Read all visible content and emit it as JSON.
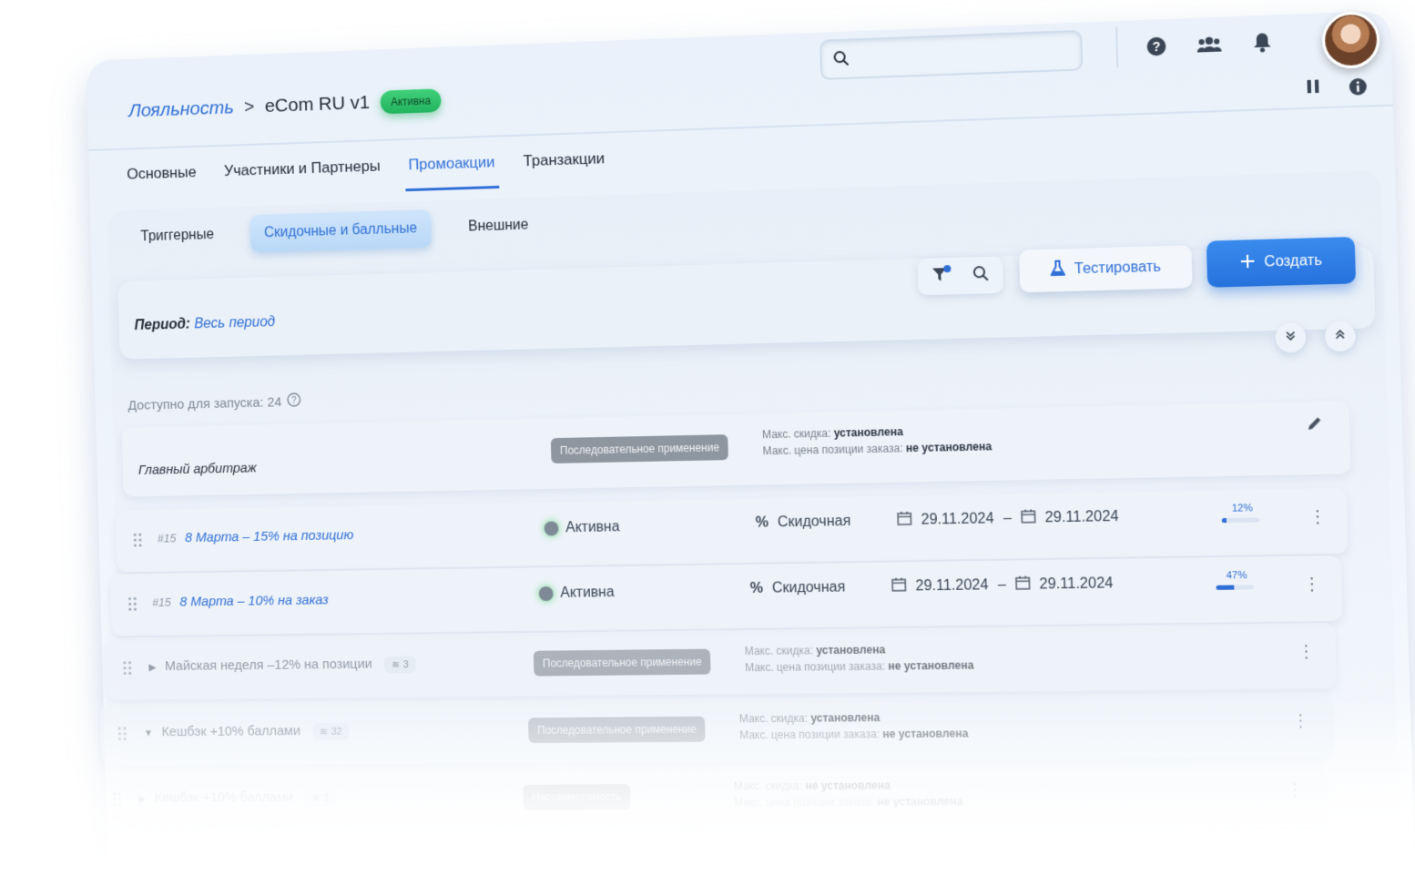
{
  "header": {
    "breadcrumb_root": "Лояльность",
    "breadcrumb_sep": ">",
    "breadcrumb_current": "eCom RU v1",
    "status_badge": "Активна"
  },
  "tabs": [
    {
      "label": "Основные"
    },
    {
      "label": "Участники и Партнеры"
    },
    {
      "label": "Промоакции"
    },
    {
      "label": "Транзакции"
    }
  ],
  "subtabs": [
    {
      "label": "Триггерные"
    },
    {
      "label": "Скидочные и балльные"
    },
    {
      "label": "Внешние"
    }
  ],
  "toolbar": {
    "test_label": "Тестировать",
    "create_label": "Создать"
  },
  "period": {
    "label": "Период:",
    "value": "Весь период"
  },
  "available": "Доступно для запуска: 24",
  "arbitrage": {
    "name": "Главный арбитраж",
    "mode": "Последовательное применение",
    "max_discount_label": "Макс. скидка:",
    "max_discount_value": "установлена",
    "max_price_label": "Макс. цена позиции заказа:",
    "max_price_value": "не установлена"
  },
  "promos": [
    {
      "id": "#15",
      "name": "8 Марта – 15% на позицию",
      "status": "Активна",
      "kind": "Скидочная",
      "date_from": "29.11.2024",
      "date_sep": "–",
      "date_to": "29.11.2024",
      "progress_label": "12%",
      "progress": 0.12
    },
    {
      "id": "#15",
      "name": "8 Марта – 10% на заказ",
      "status": "Активна",
      "kind": "Скидочная",
      "date_from": "29.11.2024",
      "date_sep": "–",
      "date_to": "29.11.2024",
      "progress_label": "47%",
      "progress": 0.47
    }
  ],
  "groups": [
    {
      "name": "Майская неделя –12% на позиции",
      "count": "3",
      "mode": "Последовательное применение",
      "max_discount_label": "Макс. скидка:",
      "max_discount_value": "установлена",
      "max_price_label": "Макс. цена позиции заказа:",
      "max_price_value": "не установлена"
    },
    {
      "name": "Кешбэк +10% баллами",
      "count": "32",
      "mode": "Последовательное применение",
      "max_discount_label": "Макс. скидка:",
      "max_discount_value": "установлена",
      "max_price_label": "Макс. цена позиции заказа:",
      "max_price_value": "не установлена"
    },
    {
      "name": "Кешбэк +10% баллами",
      "count": "1",
      "mode": "Несовместимость",
      "max_discount_label": "Макс. скидка:",
      "max_discount_value": "не установлена",
      "max_price_label": "Макс. цена позиции заказа:",
      "max_price_value": "не установлена"
    }
  ],
  "colors": {
    "accent": "#2f6fd6",
    "active_green": "#22b35e",
    "pill_gray": "#8e969f"
  }
}
